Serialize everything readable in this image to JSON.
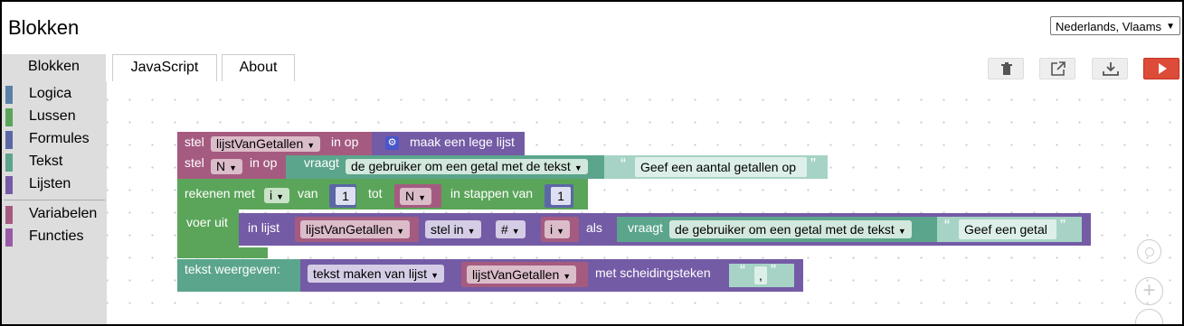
{
  "app": {
    "title": "Blokken"
  },
  "language": {
    "selected": "Nederlands, Vlaams"
  },
  "tabs": {
    "blocks": "Blokken",
    "javascript": "JavaScript",
    "about": "About"
  },
  "toolbox": {
    "categories": [
      {
        "label": "Logica",
        "color": "#5b80a5"
      },
      {
        "label": "Lussen",
        "color": "#5ba55b"
      },
      {
        "label": "Formules",
        "color": "#5b67a5"
      },
      {
        "label": "Tekst",
        "color": "#5ba58c"
      },
      {
        "label": "Lijsten",
        "color": "#745ba5"
      },
      {
        "label": "Variabelen",
        "color": "#a55b80"
      },
      {
        "label": "Functies",
        "color": "#995ba5"
      }
    ]
  },
  "toolbar": {
    "icons": [
      "trash-icon",
      "open-external-icon",
      "download-icon",
      "play-icon"
    ]
  },
  "colors": {
    "variables": "#a55b80",
    "text": "#5ba58c",
    "loops": "#5ba55b",
    "lists": "#745ba5",
    "math": "#5b67a5",
    "run": "#dd4b39"
  },
  "blocks": {
    "b1": {
      "kw": "stel",
      "var": "lijstVanGetallen",
      "in_op": "in op",
      "list": "maak een lege lijst"
    },
    "b2": {
      "kw": "stel",
      "var": "N",
      "in_op": "in op",
      "prompt_kw": "vraagt",
      "prompt_type": "de gebruiker om een getal met de tekst",
      "open_quote": "“",
      "text": "Geef een aantal getallen op",
      "close_quote": "”"
    },
    "b3": {
      "kw": "rekenen met",
      "var": "i",
      "van": "van",
      "from": "1",
      "tot": "tot",
      "to_var": "N",
      "step_kw": "in stappen van",
      "step": "1",
      "do": "voer uit"
    },
    "b4": {
      "kw": "in lijst",
      "list_var": "lijstVanGetallen",
      "mode": "stel in",
      "where": "#",
      "index_var": "i",
      "als": "als",
      "prompt_kw": "vraagt",
      "prompt_type": "de gebruiker om een getal met de tekst",
      "open_quote": "“",
      "text": "Geef een getal",
      "close_quote": "”"
    },
    "b5": {
      "kw": "tekst weergeven:",
      "mode": "tekst maken van lijst",
      "list_var": "lijstVanGetallen",
      "sep_kw": "met scheidingsteken",
      "open_quote": "“",
      "sep_value": ",",
      "close_quote": "”"
    }
  }
}
